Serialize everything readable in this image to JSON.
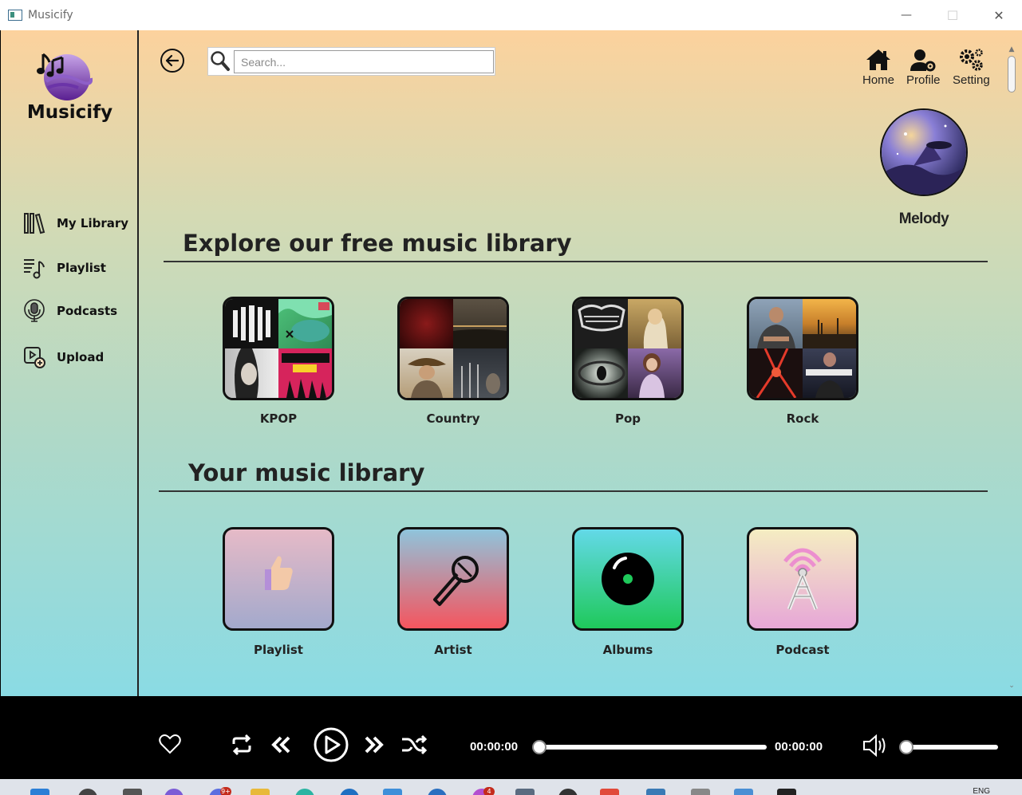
{
  "window": {
    "title": "Musicify",
    "minimize": "—",
    "maximize": "☐",
    "close": "✕"
  },
  "sidebar": {
    "brand": "Musicify",
    "items": [
      {
        "label": "My Library",
        "icon": "library-icon"
      },
      {
        "label": "Playlist",
        "icon": "playlist-icon"
      },
      {
        "label": "Podcasts",
        "icon": "podcast-mic-icon"
      },
      {
        "label": "Upload",
        "icon": "upload-icon"
      }
    ]
  },
  "search": {
    "placeholder": "Search...",
    "value": ""
  },
  "topnav": {
    "home": "Home",
    "profile": "Profile",
    "setting": "Setting"
  },
  "profile": {
    "name": "Melody"
  },
  "explore": {
    "title": "Explore our free music library",
    "genres": [
      {
        "label": "KPOP"
      },
      {
        "label": "Country"
      },
      {
        "label": "Pop"
      },
      {
        "label": "Rock"
      }
    ]
  },
  "library": {
    "title": "Your music library",
    "items": [
      {
        "label": "Playlist",
        "icon": "thumbs-up-icon"
      },
      {
        "label": "Artist",
        "icon": "microphone-icon"
      },
      {
        "label": "Albums",
        "icon": "vinyl-disc-icon"
      },
      {
        "label": "Podcast",
        "icon": "broadcast-tower-icon"
      }
    ]
  },
  "player": {
    "current_time": "00:00:00",
    "total_time": "00:00:00",
    "progress": 0,
    "volume": 0
  },
  "taskbar": {
    "lang": "ENG",
    "badge_chat": "9+",
    "badge_app": "4"
  }
}
